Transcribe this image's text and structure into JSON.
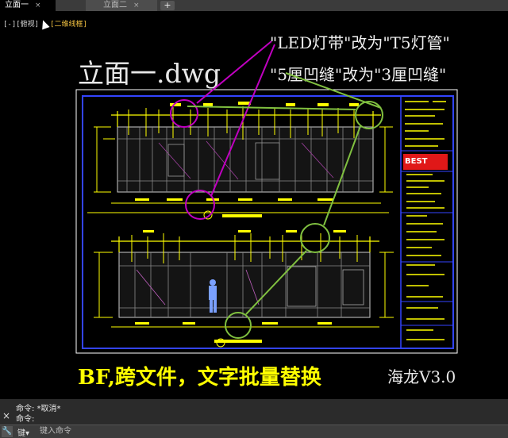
{
  "tabs": [
    {
      "label": "立面一",
      "close": "×"
    },
    {
      "label": "立面二",
      "close": "×"
    }
  ],
  "add_tab_label": "+",
  "view_controls": {
    "minus": "[-]",
    "view": "[俯视]",
    "visual_style": "[二维线框]"
  },
  "drawing_title": "立面一.dwg",
  "annotations": {
    "line1": "\"LED灯带\"改为\"T5灯管\"",
    "line2": "\"5厘凹缝\"改为\"3厘凹缝\""
  },
  "caption": "BF,跨文件，文字批量替换",
  "version_label": "海龙V3.0",
  "title_block": {
    "logo_text": "BEST"
  },
  "command": {
    "history": [
      "命令: *取消*",
      "命令:"
    ],
    "prompt": "键▾",
    "placeholder": "键入命令"
  },
  "colors": {
    "frame": "#0000ff",
    "annotation_circle_purple": "#c000c0",
    "annotation_circle_green": "#80c040",
    "dimension": "#ffff00"
  }
}
